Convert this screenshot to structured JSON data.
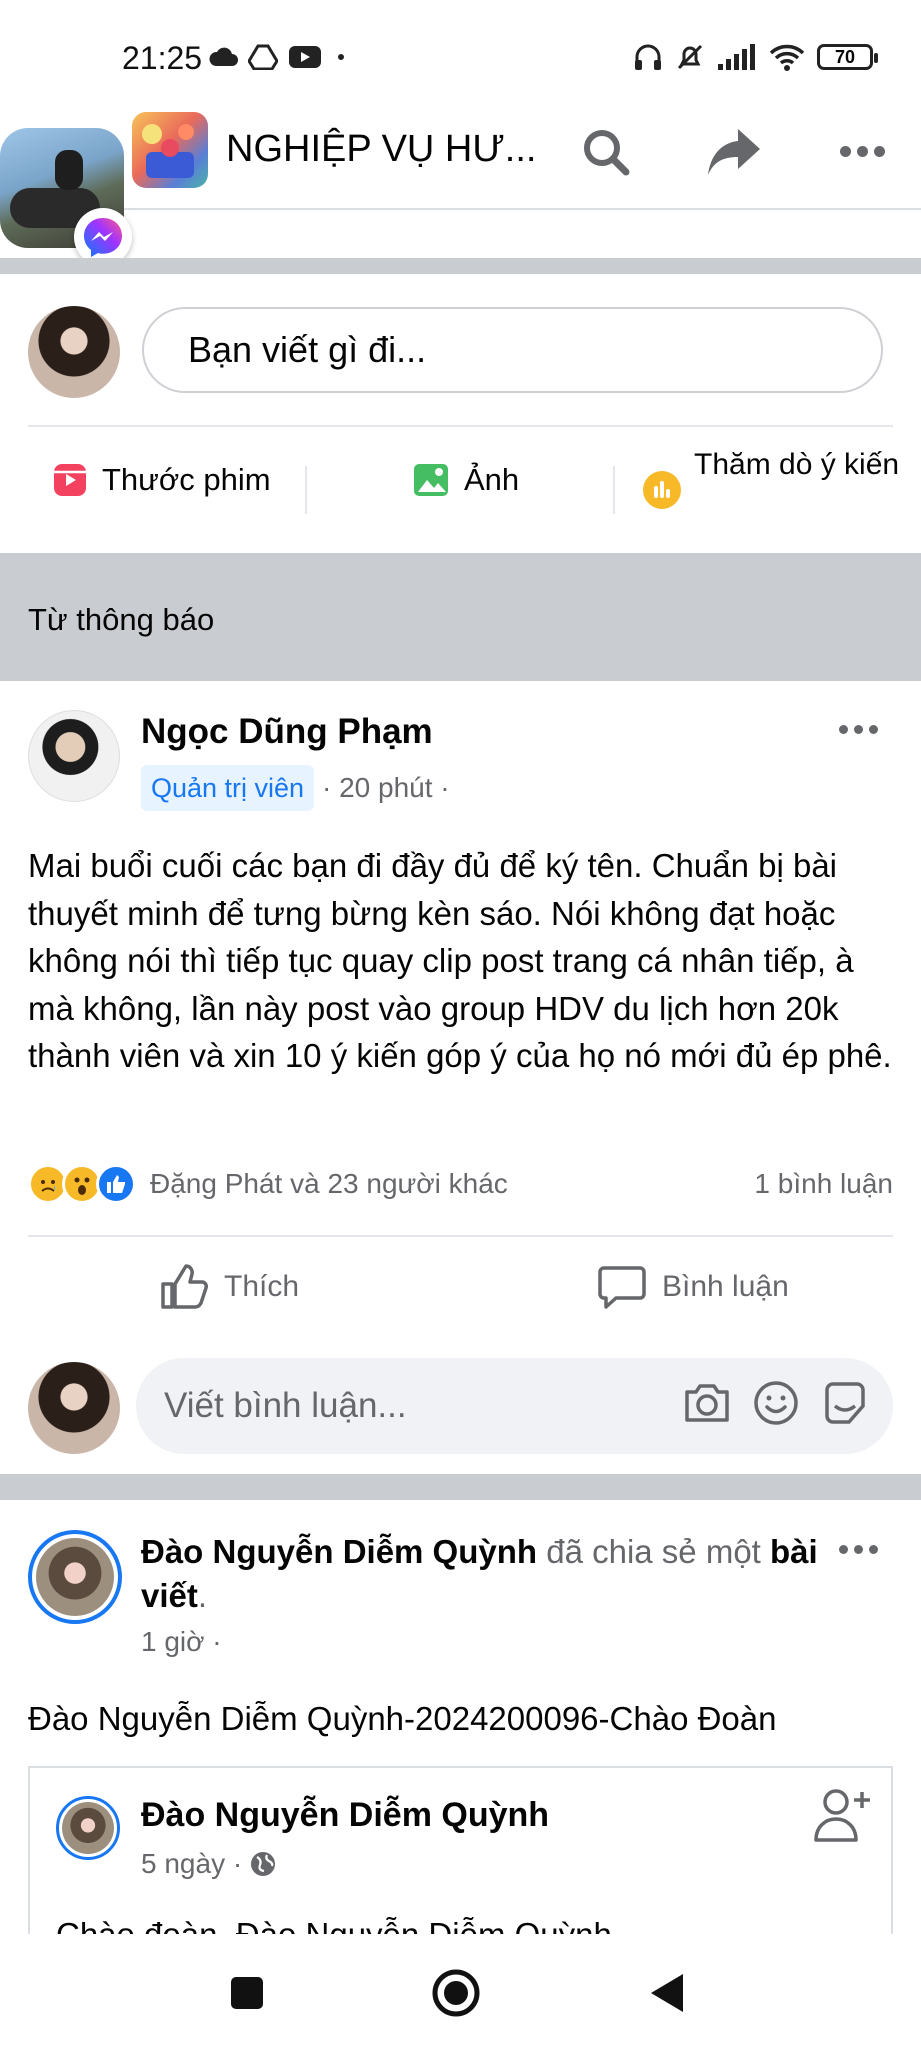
{
  "status_bar": {
    "time": "21:25",
    "battery": "70"
  },
  "header": {
    "group_title": "NGHIỆP VỤ HƯ..."
  },
  "composer": {
    "placeholder": "Bạn viết gì đi...",
    "actions": [
      {
        "label": "Thước phim",
        "icon": "reel-icon"
      },
      {
        "label": "Ảnh",
        "icon": "photo-icon"
      },
      {
        "label": "Thăm dò ý kiến",
        "icon": "poll-icon"
      }
    ]
  },
  "section": {
    "label": "Từ thông báo"
  },
  "post": {
    "author": "Ngọc Dũng Phạm",
    "role_badge": "Quản trị viên",
    "time": "· 20 phút ·",
    "body": "Mai buổi cuối các bạn đi đầy đủ để ký tên. Chuẩn bị bài thuyết minh để tưng bừng kèn sáo. Nói không đạt hoặc không nói thì tiếp tục quay clip post trang cá nhân tiếp, à mà không, lần này post vào group HDV du lịch hơn 20k thành viên và xin 10 ý kiến góp ý của họ nó mới đủ ép phê.",
    "reactions_text": "Đặng Phát và 23 người khác",
    "comment_count": "1 bình luận",
    "like_label": "Thích",
    "comment_label": "Bình luận",
    "comment_placeholder": "Viết bình luận..."
  },
  "shared_post": {
    "sharer": "Đào Nguyễn Diễm Quỳnh",
    "shared_text": " đã chia sẻ một ",
    "shared_object": "bài viết",
    "period": ".",
    "time": "1 giờ ·",
    "caption": "Đào Nguyễn Diễm Quỳnh-2024200096-Chào Đoàn",
    "inner_author": "Đào Nguyễn Diễm Quỳnh",
    "inner_time": "5 ngày ·",
    "inner_peek": "Chào đoàn, Đào Nguyễn Diễm Quỳnh..."
  }
}
